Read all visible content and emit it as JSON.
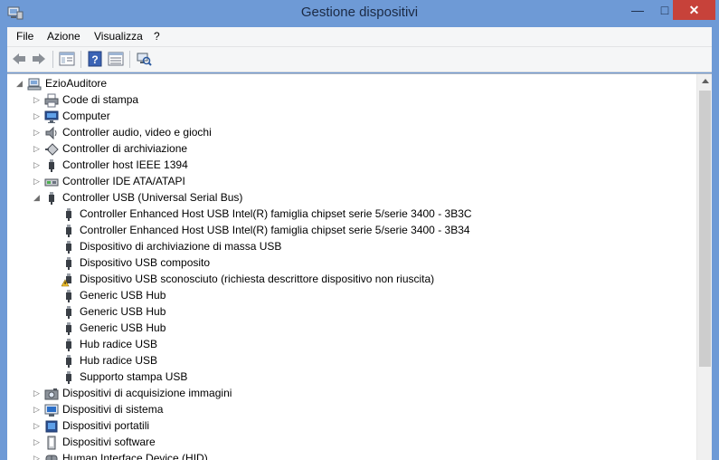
{
  "window": {
    "title": "Gestione dispositivi",
    "min_glyph": "—",
    "max_glyph": "□",
    "close_glyph": "✕"
  },
  "menu": [
    {
      "label": "File"
    },
    {
      "label": "Azione"
    },
    {
      "label": "Visualizza"
    },
    {
      "label": "?"
    }
  ],
  "toolbar": [
    "back-icon",
    "forward-icon",
    "properties-view-icon",
    "help-icon",
    "device-view-icon",
    "scan-hardware-icon"
  ],
  "tree": {
    "root": "EzioAuditore",
    "categories": [
      {
        "label": "Code di stampa",
        "icon": "printer-icon",
        "expanded": false
      },
      {
        "label": "Computer",
        "icon": "computer-icon",
        "expanded": false
      },
      {
        "label": "Controller audio, video e giochi",
        "icon": "speaker-icon",
        "expanded": false
      },
      {
        "label": "Controller di archiviazione",
        "icon": "storage-controller-icon",
        "expanded": false
      },
      {
        "label": "Controller host IEEE 1394",
        "icon": "usb-plug-icon",
        "expanded": false
      },
      {
        "label": "Controller IDE ATA/ATAPI",
        "icon": "ide-controller-icon",
        "expanded": false
      },
      {
        "label": "Controller USB (Universal Serial Bus)",
        "icon": "usb-plug-icon",
        "expanded": true,
        "children": [
          {
            "label": "Controller Enhanced Host USB Intel(R) famiglia chipset serie 5/serie 3400 - 3B3C",
            "icon": "usb-plug-icon"
          },
          {
            "label": "Controller Enhanced Host USB Intel(R) famiglia chipset serie 5/serie 3400 - 3B34",
            "icon": "usb-plug-icon"
          },
          {
            "label": "Dispositivo di archiviazione di massa USB",
            "icon": "usb-plug-icon"
          },
          {
            "label": "Dispositivo USB composito",
            "icon": "usb-plug-icon"
          },
          {
            "label": "Dispositivo USB sconosciuto (richiesta descrittore dispositivo non riuscita)",
            "icon": "usb-warning-icon"
          },
          {
            "label": "Generic USB Hub",
            "icon": "usb-plug-icon"
          },
          {
            "label": "Generic USB Hub",
            "icon": "usb-plug-icon"
          },
          {
            "label": "Generic USB Hub",
            "icon": "usb-plug-icon"
          },
          {
            "label": "Hub radice USB",
            "icon": "usb-plug-icon"
          },
          {
            "label": "Hub radice USB",
            "icon": "usb-plug-icon"
          },
          {
            "label": "Supporto stampa USB",
            "icon": "usb-plug-icon"
          }
        ]
      },
      {
        "label": "Dispositivi di acquisizione immagini",
        "icon": "camera-icon",
        "expanded": false
      },
      {
        "label": "Dispositivi di sistema",
        "icon": "system-devices-icon",
        "expanded": false
      },
      {
        "label": "Dispositivi portatili",
        "icon": "portable-device-icon",
        "expanded": false
      },
      {
        "label": "Dispositivi software",
        "icon": "software-device-icon",
        "expanded": false
      },
      {
        "label": "Human Interface Device (HID)",
        "icon": "hid-icon",
        "expanded": false
      }
    ]
  },
  "colors": {
    "title_bar": "#6e9ad6",
    "close_button": "#c7423a",
    "warning": "#f2c12e"
  }
}
